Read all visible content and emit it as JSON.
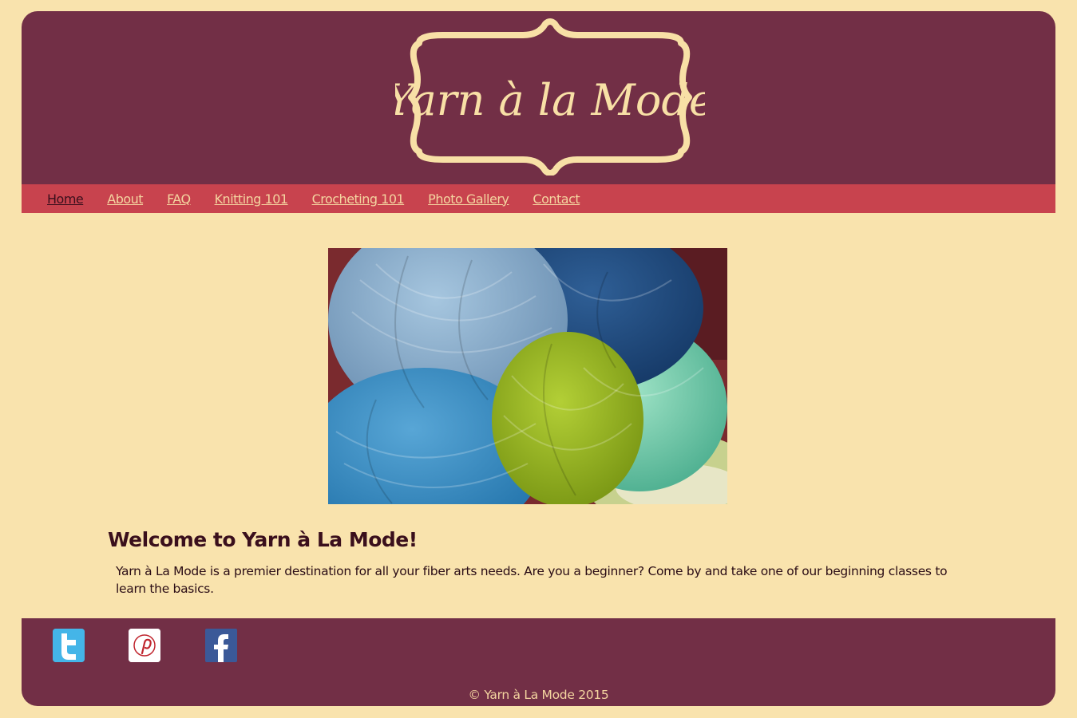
{
  "site": {
    "logo_text": "Yarn à la Mode"
  },
  "nav": {
    "items": [
      {
        "label": "Home",
        "active": true
      },
      {
        "label": "About"
      },
      {
        "label": "FAQ"
      },
      {
        "label": "Knitting 101"
      },
      {
        "label": "Crocheting 101"
      },
      {
        "label": "Photo Gallery"
      },
      {
        "label": "Contact"
      }
    ]
  },
  "main": {
    "hero_image": "yarn-balls-photo",
    "heading": "Welcome to Yarn à La Mode!",
    "intro": "Yarn à La Mode is a premier destination for all your fiber arts needs. Are you a beginner? Come by and take one of our beginning classes to learn the basics."
  },
  "footer": {
    "social": [
      {
        "icon": "twitter-icon"
      },
      {
        "icon": "pinterest-icon"
      },
      {
        "icon": "facebook-icon"
      }
    ],
    "copyright": "© Yarn à La Mode 2015"
  },
  "colors": {
    "background": "#f9e3ad",
    "header": "#722f46",
    "nav": "#c8434e",
    "link": "#f4d5a0",
    "active_link": "#3a0f1c"
  }
}
